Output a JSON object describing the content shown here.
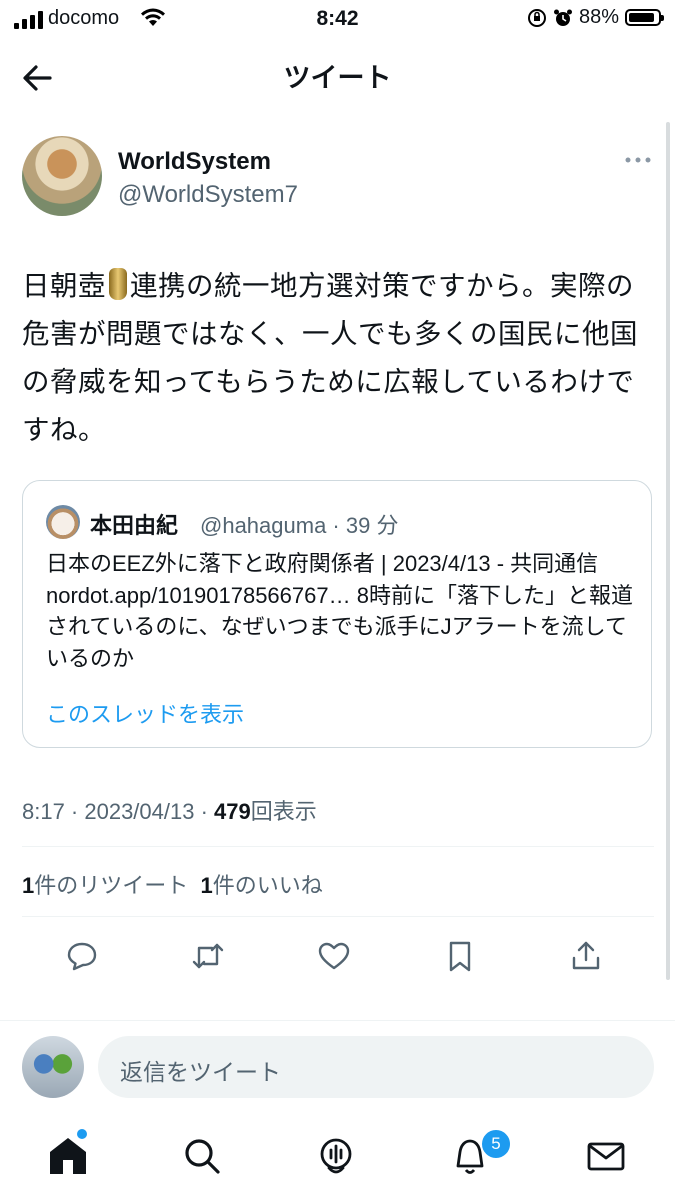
{
  "status_bar": {
    "carrier": "docomo",
    "time": "8:42",
    "battery": "88%",
    "battery_level": 0.88
  },
  "header": {
    "title": "ツイート"
  },
  "tweet": {
    "author_name": "WorldSystem",
    "author_handle": "@WorldSystem7",
    "text_before": "日朝壺",
    "text_after": "連携の統一地方選対策ですから。実際の危害が問題ではなく、一人でも多くの国民に他国の脅威を知ってもらうために広報しているわけですね。",
    "time": "8:17 · 2023/04/13 · ",
    "views_count": "479",
    "views_label": "回表示",
    "retweet_count": "1",
    "retweet_label": "件のリツイート",
    "like_count": "1",
    "like_label": "件のいいね"
  },
  "quote": {
    "name": "本田由紀",
    "handle": "@hahaguma · 39 分",
    "text": "日本のEEZ外に落下と政府関係者 | 2023/4/13 - 共同通信 nordot.app/10190178566767… 8時前に「落下した」と報道されているのに、なぜいつまでも派手にJアラートを流しているのか",
    "thread_link": "このスレッドを表示"
  },
  "reply": {
    "placeholder": "返信をツイート"
  },
  "notifications": {
    "badge": "5"
  },
  "colors": {
    "accent": "#1d9bf0",
    "secondary_text": "#536471"
  }
}
